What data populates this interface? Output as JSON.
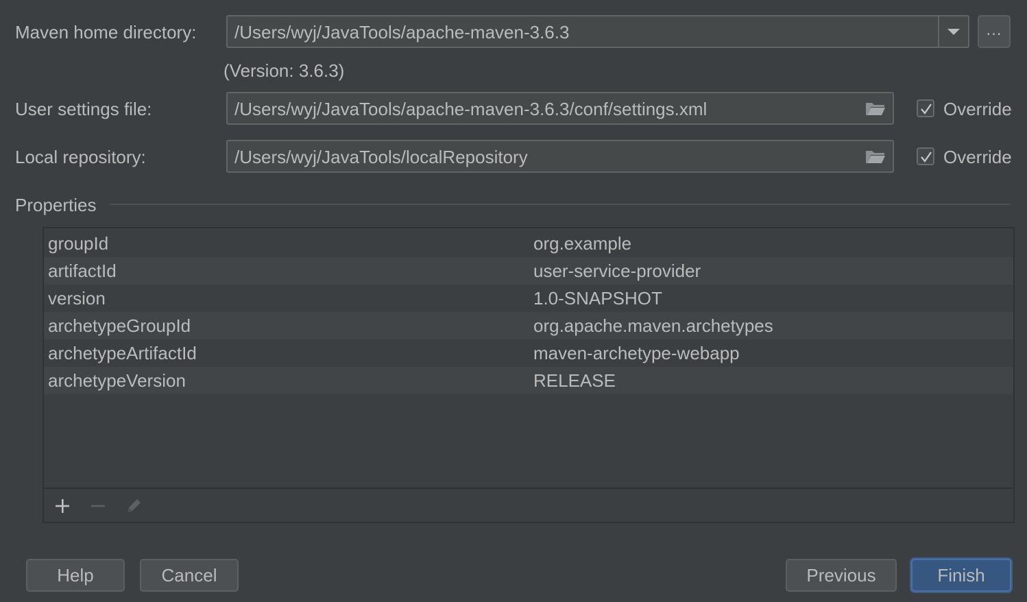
{
  "maven_home": {
    "label": "Maven home directory:",
    "value": "/Users/wyj/JavaTools/apache-maven-3.6.3",
    "browse_label": "...",
    "version_text": "(Version: 3.6.3)"
  },
  "user_settings": {
    "label": "User settings file:",
    "value": "/Users/wyj/JavaTools/apache-maven-3.6.3/conf/settings.xml",
    "override_label": "Override",
    "override_checked": true
  },
  "local_repo": {
    "label": "Local repository:",
    "value": "/Users/wyj/JavaTools/localRepository",
    "override_label": "Override",
    "override_checked": true
  },
  "properties": {
    "title": "Properties",
    "rows": [
      {
        "key": "groupId",
        "value": "org.example"
      },
      {
        "key": "artifactId",
        "value": "user-service-provider"
      },
      {
        "key": "version",
        "value": "1.0-SNAPSHOT"
      },
      {
        "key": "archetypeGroupId",
        "value": "org.apache.maven.archetypes"
      },
      {
        "key": "archetypeArtifactId",
        "value": "maven-archetype-webapp"
      },
      {
        "key": "archetypeVersion",
        "value": "RELEASE"
      }
    ],
    "toolbar": [
      "plus-icon",
      "minus-icon",
      "pencil-icon"
    ]
  },
  "footer": {
    "help": "Help",
    "cancel": "Cancel",
    "previous": "Previous",
    "finish": "Finish"
  },
  "colors": {
    "background": "#3c3f41",
    "field_bg": "#45494a",
    "primary_button": "#365880"
  }
}
